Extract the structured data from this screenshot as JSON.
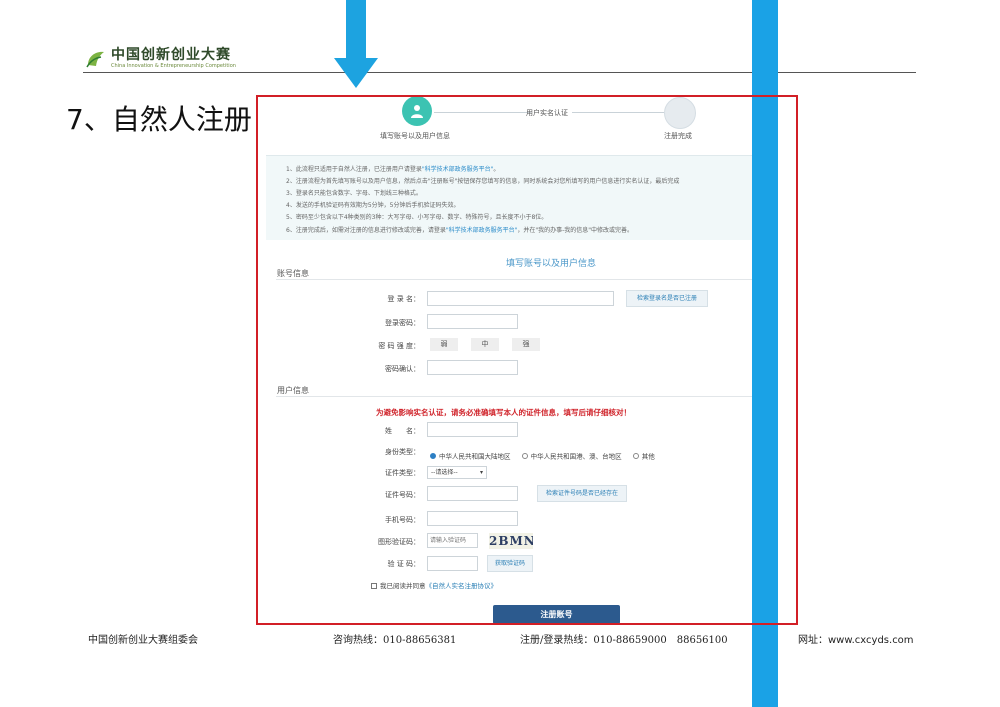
{
  "slide": {
    "logo_cn": "中国创新创业大赛",
    "logo_en": "China Innovation & Entrepreneurship Competition",
    "title": "7、自然人注册"
  },
  "stepper": {
    "steps": [
      {
        "label": "填写账号以及用户信息"
      },
      {
        "label": "用户实名认证"
      },
      {
        "label": "注册完成"
      }
    ]
  },
  "notice": {
    "items": [
      {
        "pre": "1、此流程只适用于自然人注册，已注册用户请登录",
        "link": "\"科学技术部政务服务平台\"",
        "post": "。"
      },
      {
        "pre": "2、注册流程为首先填写账号以及用户信息，然后点击\"注册账号\"按钮保存您填写的信息，同时系统会对您所填写的用户信息进行实名认证，最后完成",
        "link": "",
        "post": ""
      },
      {
        "pre": "3、登录名只能包含数字、字母、下划线三种格式。",
        "link": "",
        "post": ""
      },
      {
        "pre": "4、发送的手机验证码有效期为5分钟，5分钟后手机验证码失效。",
        "link": "",
        "post": ""
      },
      {
        "pre": "5、密码至少包含以下4种类别的3种：大写字母、小写字母、数字、特殊符号，且长度不小于8位。",
        "link": "",
        "post": ""
      },
      {
        "pre": "6、注册完成后，如需对注册的信息进行修改或完善，请登录",
        "link": "\"科学技术部政务服务平台\"",
        "post": "，并在\"我的办事-我的信息\"中修改或完善。"
      }
    ]
  },
  "form": {
    "heading": "填写账号以及用户信息",
    "account_section": "账号信息",
    "user_section": "用户信息",
    "login_label": "登 录 名：",
    "check_login_btn": "检索登录名是否已注册",
    "password_label": "登录密码：",
    "strength_label": "密 码 强 度：",
    "strength_levels": [
      "弱",
      "中",
      "强"
    ],
    "confirm_label": "密码确认：",
    "warning": "为避免影响实名认证，请务必准确填写本人的证件信息，填写后请仔细核对！",
    "name_label": "姓　　名：",
    "identity_label": "身份类型：",
    "identity_options": [
      {
        "label": "中华人民共和国大陆地区",
        "selected": true
      },
      {
        "label": "中华人民共和国港、澳、台地区",
        "selected": false
      },
      {
        "label": "其他",
        "selected": false
      }
    ],
    "cert_type_label": "证件类型：",
    "cert_type_value": "--请选择--",
    "cert_no_label": "证件号码：",
    "check_cert_btn": "检索证件号码是否已经存在",
    "phone_label": "手机号码：",
    "captcha_label": "图形验证码：",
    "captcha_placeholder": "请输入验证码",
    "captcha_text": "2BMN",
    "sms_label": "验 证 码：",
    "sms_btn": "获取验证码",
    "agree_pre": "我已阅读并同意",
    "agree_link": "《自然人实名注册协议》",
    "submit": "注册账号"
  },
  "footer": {
    "org": "中国创新创业大赛组委会",
    "hotline": "咨询热线：010-88656381",
    "register_hotline": "注册/登录热线：010-88659000　88656100",
    "website": "网址：www.cxcyds.com"
  },
  "colors": {
    "accent_blue": "#1da3e0",
    "frame_red": "#d21f26",
    "step_active": "#3cc3b2",
    "submit_bg": "#2c5a8e",
    "warning_red": "#d0252c"
  }
}
